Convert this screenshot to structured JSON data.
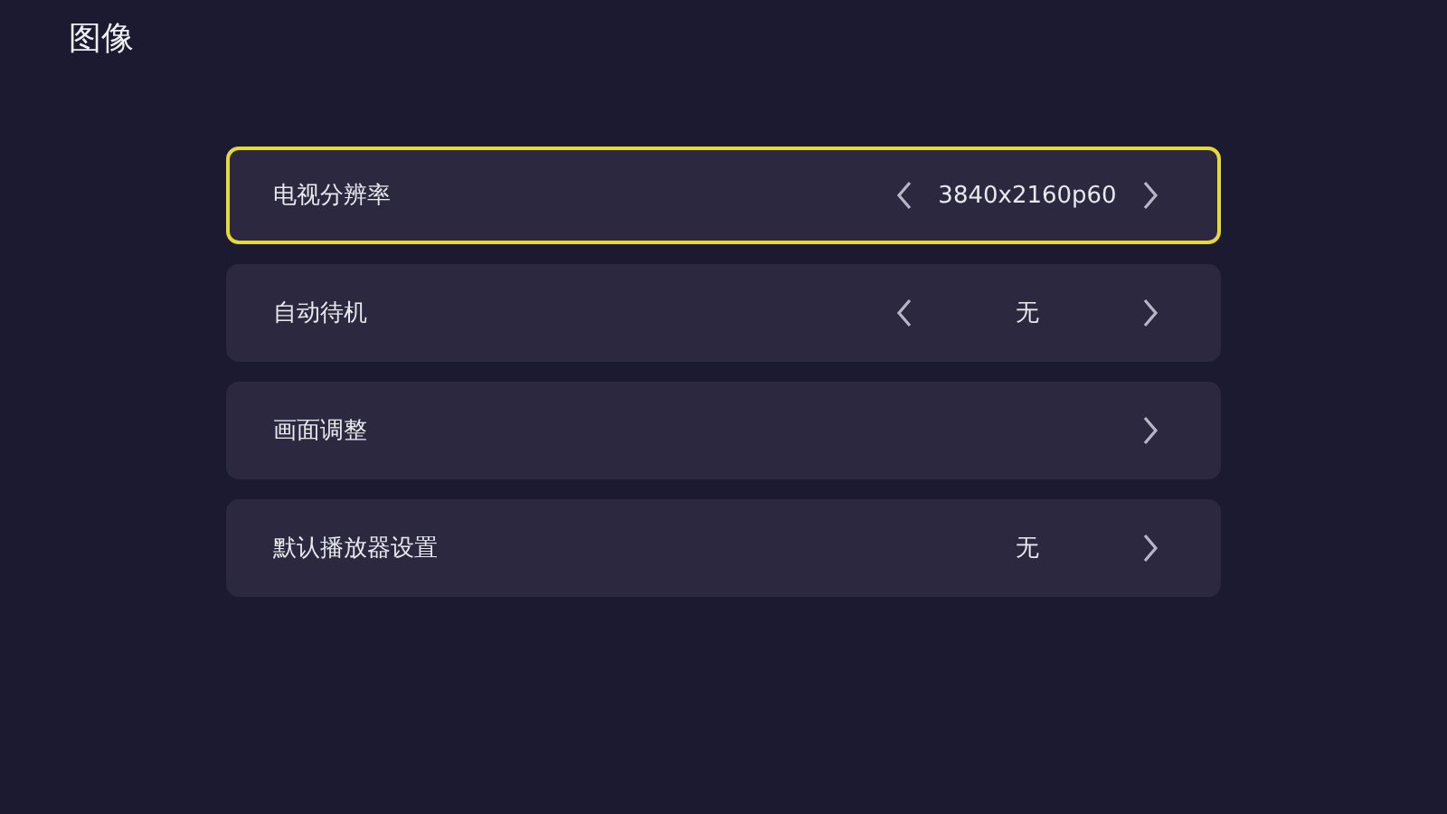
{
  "title": "图像",
  "items": [
    {
      "kind": "selector",
      "label": "电视分辨率",
      "value": "3840x2160p60",
      "selected": true
    },
    {
      "kind": "selector",
      "label": "自动待机",
      "value": "无",
      "selected": false
    },
    {
      "kind": "submenu",
      "label": "画面调整",
      "selected": false
    },
    {
      "kind": "submenu",
      "label": "默认播放器设置",
      "value": "无",
      "selected": false
    }
  ]
}
